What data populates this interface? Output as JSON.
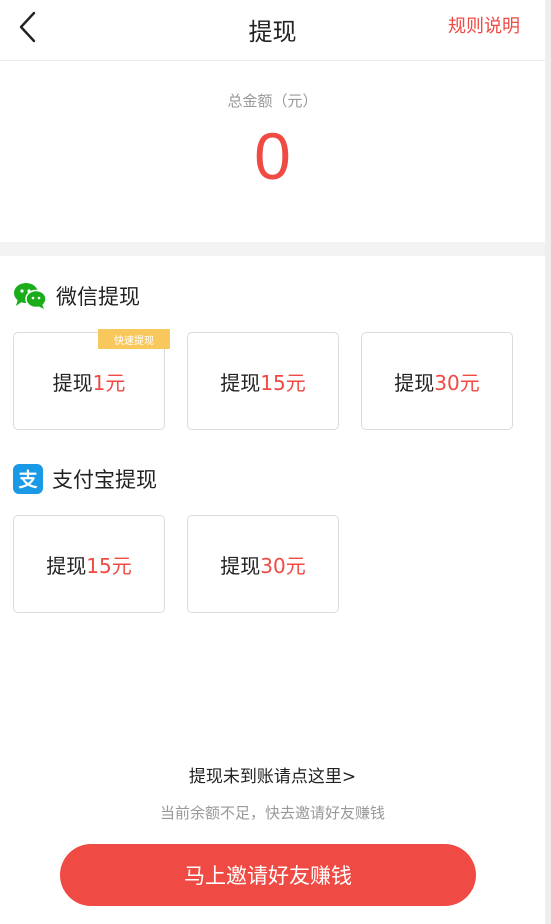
{
  "header": {
    "title": "提现",
    "rules_label": "规则说明"
  },
  "total": {
    "label": "总金额（元）",
    "value": "0"
  },
  "wechat": {
    "title": "微信提现",
    "options": [
      {
        "prefix": "提现",
        "amount": "1元",
        "badge": "快速提现"
      },
      {
        "prefix": "提现",
        "amount": "15元"
      },
      {
        "prefix": "提现",
        "amount": "30元"
      }
    ]
  },
  "alipay": {
    "title": "支付宝提现",
    "options": [
      {
        "prefix": "提现",
        "amount": "15元"
      },
      {
        "prefix": "提现",
        "amount": "30元"
      }
    ]
  },
  "footer": {
    "not_arrived_link": "提现未到账请点这里>",
    "hint": "当前余额不足，快去邀请好友赚钱",
    "invite_button": "马上邀请好友赚钱"
  },
  "colors": {
    "accent": "#f04a44",
    "badge": "#f9c85c",
    "wechat": "#1aad19",
    "alipay": "#1a9ae6"
  }
}
